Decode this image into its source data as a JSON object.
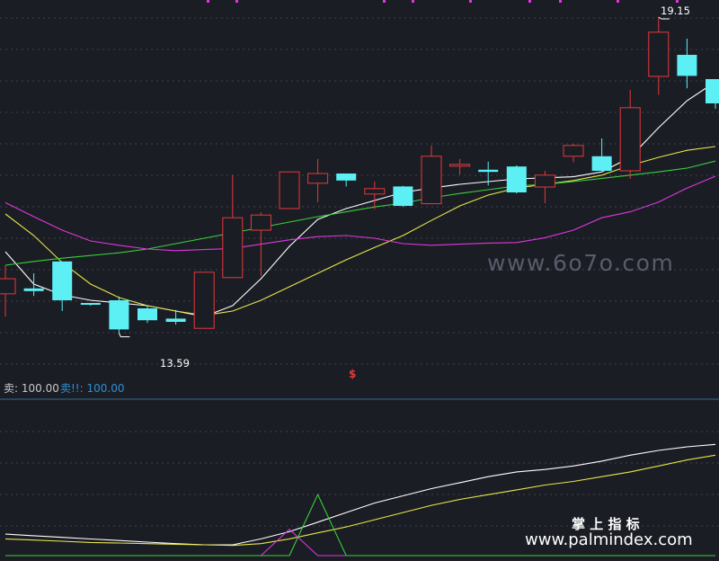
{
  "chart_data": [
    {
      "type": "candlestick",
      "panel": "main",
      "y_range": [
        12.8,
        19.3
      ],
      "price_labels": {
        "high": "19.15",
        "low": "13.59"
      },
      "signal_marker": "$",
      "candles": [
        {
          "o": 14.02,
          "h": 14.55,
          "l": 13.6,
          "c": 14.3
        },
        {
          "o": 14.12,
          "h": 14.4,
          "l": 13.98,
          "c": 14.07
        },
        {
          "o": 14.62,
          "h": 14.5,
          "l": 13.7,
          "c": 13.9
        },
        {
          "o": 13.85,
          "h": 13.85,
          "l": 13.8,
          "c": 13.83
        },
        {
          "o": 13.9,
          "h": 13.97,
          "l": 13.29,
          "c": 13.36
        },
        {
          "o": 13.75,
          "h": 13.8,
          "l": 13.48,
          "c": 13.53
        },
        {
          "o": 13.56,
          "h": 13.72,
          "l": 13.45,
          "c": 13.5
        },
        {
          "o": 13.38,
          "h": 13.38,
          "l": 14.42,
          "c": 14.42
        },
        {
          "o": 14.32,
          "h": 16.22,
          "l": 14.32,
          "c": 15.43
        },
        {
          "o": 15.2,
          "h": 15.53,
          "l": 14.35,
          "c": 15.48
        },
        {
          "o": 15.6,
          "h": 16.02,
          "l": 15.6,
          "c": 16.28
        },
        {
          "o": 16.07,
          "h": 16.52,
          "l": 15.72,
          "c": 16.25
        },
        {
          "o": 16.25,
          "h": 16.23,
          "l": 16.01,
          "c": 16.12
        },
        {
          "o": 15.87,
          "h": 16.1,
          "l": 15.59,
          "c": 15.97
        },
        {
          "o": 16.01,
          "h": 16.02,
          "l": 15.63,
          "c": 15.65
        },
        {
          "o": 15.69,
          "h": 16.77,
          "l": 15.69,
          "c": 16.57
        },
        {
          "o": 16.42,
          "h": 16.52,
          "l": 16.23,
          "c": 16.42
        },
        {
          "o": 16.32,
          "h": 16.47,
          "l": 16.03,
          "c": 16.28
        },
        {
          "o": 16.38,
          "h": 16.4,
          "l": 15.88,
          "c": 15.9
        },
        {
          "o": 16.0,
          "h": 16.3,
          "l": 15.7,
          "c": 16.22
        },
        {
          "o": 16.57,
          "h": 16.8,
          "l": 16.46,
          "c": 16.77
        },
        {
          "o": 16.57,
          "h": 16.9,
          "l": 16.3,
          "c": 16.3
        },
        {
          "o": 16.3,
          "h": 17.8,
          "l": 16.15,
          "c": 17.47
        },
        {
          "o": 18.05,
          "h": 19.15,
          "l": 17.71,
          "c": 18.87
        },
        {
          "o": 18.45,
          "h": 18.75,
          "l": 17.83,
          "c": 18.06
        },
        {
          "o": 18.0,
          "h": 18.0,
          "l": 17.45,
          "c": 17.55
        }
      ],
      "series": [
        {
          "name": "",
          "color": "#ffffff",
          "values": [
            14.8,
            14.2,
            14.0,
            13.9,
            13.85,
            13.8,
            13.7,
            13.6,
            13.8,
            14.3,
            14.9,
            15.4,
            15.6,
            15.75,
            15.9,
            15.98,
            16.05,
            16.1,
            16.15,
            16.17,
            16.19,
            16.28,
            16.55,
            17.1,
            17.6,
            17.95
          ]
        },
        {
          "name": "",
          "color": "#e6e64c",
          "values": [
            15.5,
            15.1,
            14.6,
            14.2,
            13.95,
            13.8,
            13.7,
            13.62,
            13.7,
            13.9,
            14.15,
            14.4,
            14.65,
            14.88,
            15.1,
            15.38,
            15.65,
            15.85,
            15.98,
            16.05,
            16.12,
            16.22,
            16.4,
            16.55,
            16.68,
            16.75
          ]
        },
        {
          "name": "",
          "color": "#39d039",
          "values": [
            14.55,
            14.62,
            14.68,
            14.73,
            14.78,
            14.85,
            14.95,
            15.05,
            15.15,
            15.25,
            15.35,
            15.45,
            15.54,
            15.63,
            15.7,
            15.8,
            15.88,
            15.95,
            16.02,
            16.05,
            16.1,
            16.16,
            16.22,
            16.28,
            16.35,
            16.48
          ]
        },
        {
          "name": "",
          "color": "#dd38dd",
          "values": [
            15.71,
            15.45,
            15.2,
            15.0,
            14.92,
            14.85,
            14.82,
            14.84,
            14.86,
            14.94,
            15.02,
            15.08,
            15.1,
            15.05,
            14.95,
            14.92,
            14.94,
            14.96,
            14.97,
            15.06,
            15.2,
            15.43,
            15.54,
            15.72,
            15.98,
            16.2
          ]
        }
      ]
    },
    {
      "type": "line",
      "panel": "indicator",
      "legend": [
        {
          "label": "卖: 100.00",
          "color": "#c8c8c8"
        },
        {
          "label": "卖!!: 100.00",
          "color": "#2d8fd5"
        }
      ],
      "y_range": [
        0,
        100
      ],
      "series": [
        {
          "name": "",
          "color": "#ffffff",
          "values": [
            18,
            16.6,
            15.3,
            13.9,
            12.6,
            11.3,
            10.0,
            9.0,
            9.0,
            14.0,
            20.0,
            28.0,
            36.0,
            44.0,
            50.0,
            56.0,
            61.0,
            66.0,
            70.0,
            72.0,
            75.0,
            79.0,
            84.0,
            88.0,
            91.0,
            93.0
          ]
        },
        {
          "name": "",
          "color": "#e6e64c",
          "values": [
            14,
            13,
            12,
            11,
            10.5,
            10,
            9.5,
            9,
            8.5,
            10,
            14,
            19,
            24,
            30,
            36,
            42,
            47,
            51,
            55,
            59,
            62,
            66,
            70,
            75,
            80,
            84
          ]
        },
        {
          "name": "",
          "color": "#dd38dd",
          "values": [
            0,
            0,
            0,
            0,
            0,
            0,
            0,
            0,
            0,
            0,
            22,
            0,
            0,
            0,
            0,
            0,
            0,
            0,
            0,
            0,
            0,
            0,
            0,
            0,
            0,
            0
          ]
        },
        {
          "name": "",
          "color": "#39d039",
          "values": [
            0,
            0,
            0,
            0,
            0,
            0,
            0,
            0,
            0,
            0,
            0,
            51,
            0,
            0,
            0,
            0,
            0,
            0,
            0,
            0,
            0,
            0,
            0,
            0,
            0,
            0
          ]
        }
      ]
    }
  ],
  "watermarks": {
    "site": "www.6o7o.com",
    "brand_cn": "掌 上 指 标",
    "brand_url": "www.palmindex.com"
  },
  "colors": {
    "background": "#1b1d24",
    "up": "#e5393c",
    "down": "#5cf0f5",
    "grid": "#3c4150",
    "divider": "#2c6d95"
  }
}
